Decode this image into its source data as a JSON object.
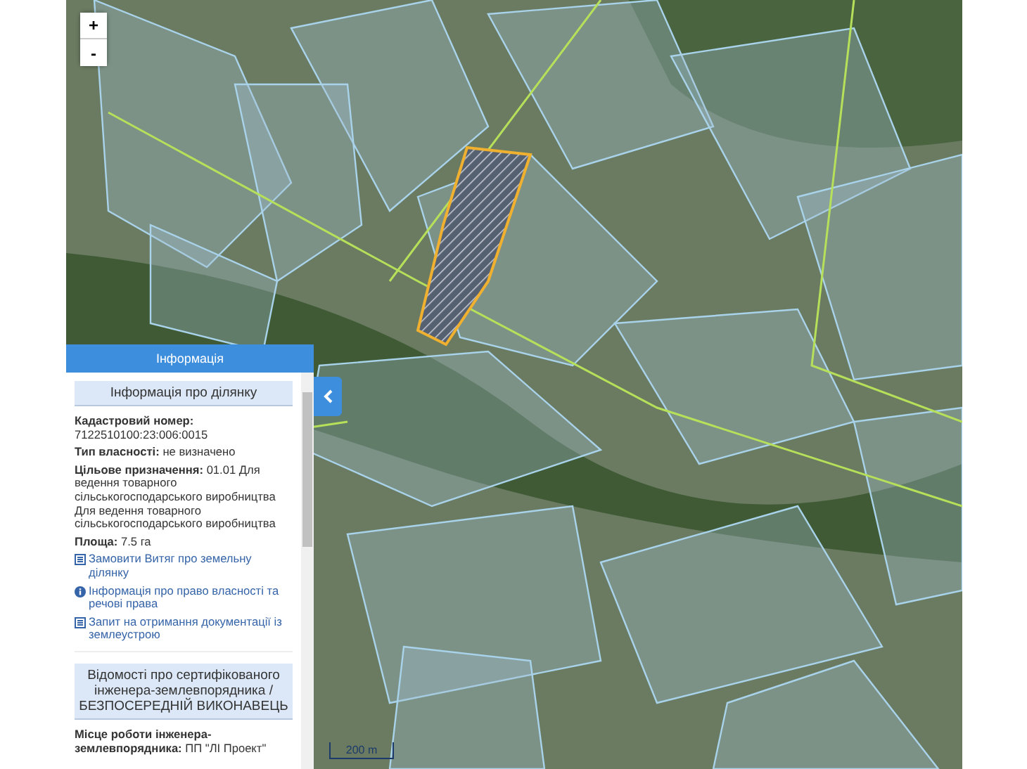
{
  "map": {
    "zoom_in": "+",
    "zoom_out": "-",
    "scale": "200 m"
  },
  "panel": {
    "title": "Інформація",
    "section_1": {
      "heading": "Інформація про ділянку",
      "fields": [
        {
          "label": "Кадастровий номер:",
          "value": "7122510100:23:006:0015"
        },
        {
          "label": "Тип власності:",
          "value": "не визначено"
        },
        {
          "label": "Цільове призначення:",
          "value": "01.01 Для ведення товарного сільськогосподарського виробництва Для ведення товарного сільськогосподарського виробництва"
        },
        {
          "label": "Площа:",
          "value": "7.5 га"
        }
      ],
      "links": [
        {
          "kind": "document",
          "text": "Замовити Витяг про земельну ділянку"
        },
        {
          "kind": "info",
          "text": "Інформація про право власності та речові права"
        },
        {
          "kind": "document",
          "text": "Запит на отримання документації із землеустрою"
        }
      ]
    },
    "section_2": {
      "heading": "Відомості про сертифікованого інженера-землевпорядника / БЕЗПОСЕРЕДНІЙ ВИКОНАВЕЦЬ",
      "fields": [
        {
          "label": "Місце роботи інженера-землевпорядника:",
          "value": "ПП \"ЛІ Проект\""
        }
      ]
    }
  }
}
